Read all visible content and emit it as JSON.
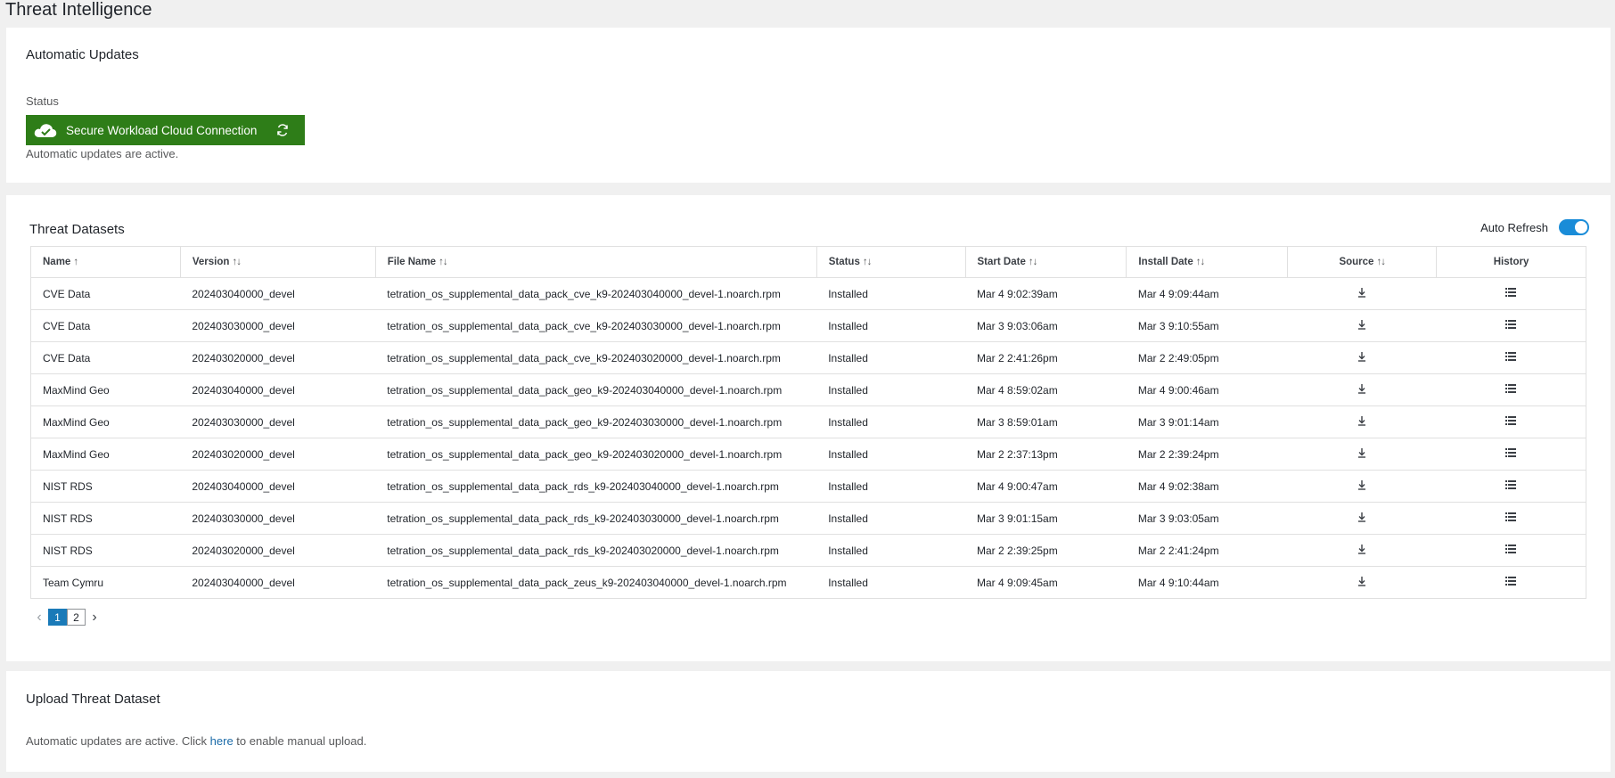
{
  "page": {
    "title": "Threat Intelligence"
  },
  "automatic_updates": {
    "title": "Automatic Updates",
    "status_label": "Status",
    "connection_label": "Secure Workload Cloud Connection",
    "connection_color": "#2e7d18",
    "note": "Automatic updates are active."
  },
  "datasets": {
    "title": "Threat Datasets",
    "auto_refresh_label": "Auto Refresh",
    "auto_refresh_on": true,
    "columns": {
      "name": "Name",
      "version": "Version",
      "file_name": "File Name",
      "status": "Status",
      "start_date": "Start Date",
      "install_date": "Install Date",
      "source": "Source",
      "history": "History"
    },
    "rows": [
      {
        "name": "CVE Data",
        "version": "202403040000_devel",
        "file_name": "tetration_os_supplemental_data_pack_cve_k9-202403040000_devel-1.noarch.rpm",
        "status": "Installed",
        "start_date": "Mar 4 9:02:39am",
        "install_date": "Mar 4 9:09:44am"
      },
      {
        "name": "CVE Data",
        "version": "202403030000_devel",
        "file_name": "tetration_os_supplemental_data_pack_cve_k9-202403030000_devel-1.noarch.rpm",
        "status": "Installed",
        "start_date": "Mar 3 9:03:06am",
        "install_date": "Mar 3 9:10:55am"
      },
      {
        "name": "CVE Data",
        "version": "202403020000_devel",
        "file_name": "tetration_os_supplemental_data_pack_cve_k9-202403020000_devel-1.noarch.rpm",
        "status": "Installed",
        "start_date": "Mar 2 2:41:26pm",
        "install_date": "Mar 2 2:49:05pm"
      },
      {
        "name": "MaxMind Geo",
        "version": "202403040000_devel",
        "file_name": "tetration_os_supplemental_data_pack_geo_k9-202403040000_devel-1.noarch.rpm",
        "status": "Installed",
        "start_date": "Mar 4 8:59:02am",
        "install_date": "Mar 4 9:00:46am"
      },
      {
        "name": "MaxMind Geo",
        "version": "202403030000_devel",
        "file_name": "tetration_os_supplemental_data_pack_geo_k9-202403030000_devel-1.noarch.rpm",
        "status": "Installed",
        "start_date": "Mar 3 8:59:01am",
        "install_date": "Mar 3 9:01:14am"
      },
      {
        "name": "MaxMind Geo",
        "version": "202403020000_devel",
        "file_name": "tetration_os_supplemental_data_pack_geo_k9-202403020000_devel-1.noarch.rpm",
        "status": "Installed",
        "start_date": "Mar 2 2:37:13pm",
        "install_date": "Mar 2 2:39:24pm"
      },
      {
        "name": "NIST RDS",
        "version": "202403040000_devel",
        "file_name": "tetration_os_supplemental_data_pack_rds_k9-202403040000_devel-1.noarch.rpm",
        "status": "Installed",
        "start_date": "Mar 4 9:00:47am",
        "install_date": "Mar 4 9:02:38am"
      },
      {
        "name": "NIST RDS",
        "version": "202403030000_devel",
        "file_name": "tetration_os_supplemental_data_pack_rds_k9-202403030000_devel-1.noarch.rpm",
        "status": "Installed",
        "start_date": "Mar 3 9:01:15am",
        "install_date": "Mar 3 9:03:05am"
      },
      {
        "name": "NIST RDS",
        "version": "202403020000_devel",
        "file_name": "tetration_os_supplemental_data_pack_rds_k9-202403020000_devel-1.noarch.rpm",
        "status": "Installed",
        "start_date": "Mar 2 2:39:25pm",
        "install_date": "Mar 2 2:41:24pm"
      },
      {
        "name": "Team Cymru",
        "version": "202403040000_devel",
        "file_name": "tetration_os_supplemental_data_pack_zeus_k9-202403040000_devel-1.noarch.rpm",
        "status": "Installed",
        "start_date": "Mar 4 9:09:45am",
        "install_date": "Mar 4 9:10:44am"
      }
    ],
    "pagination": {
      "pages": [
        "1",
        "2"
      ],
      "current": "1"
    }
  },
  "upload": {
    "title": "Upload Threat Dataset",
    "note_before": "Automatic updates are active. Click ",
    "link_text": "here",
    "note_after": " to enable manual upload."
  },
  "icons": {
    "cloud": "cloud-check-icon",
    "refresh": "refresh-icon",
    "download": "download-icon",
    "history": "list-icon"
  }
}
